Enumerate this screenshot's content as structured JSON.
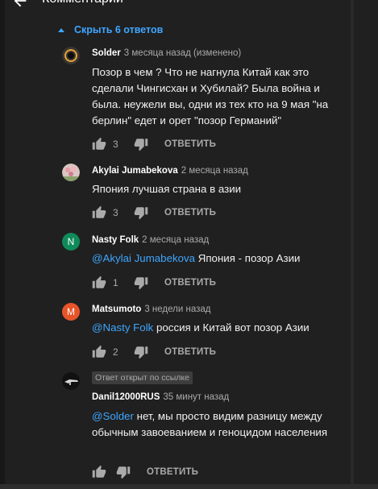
{
  "header": {
    "title": "Комментарии",
    "back_icon": "arrow-left-icon"
  },
  "collapse_label": "Скрыть 6 ответов",
  "colors": {
    "background": "#202020",
    "link": "#3ea6ff",
    "text": "#f1f1f1",
    "secondary": "#aaaaaa",
    "avatar_n": "#0f8b5a",
    "avatar_m": "#e8542a"
  },
  "replies": [
    {
      "author": "Solder",
      "time": "3 месяца назад (изменено)",
      "text": "Позор в чем ? Что не нагнула Китай как это сделали Чингисхан и Хубилай?   Была война и была. неужели вы, одни из тех кто на 9 мая \"на берлин\" едет и орет \"позор Германий\"",
      "likes": "3",
      "reply_label": "ОТВЕТИТЬ"
    },
    {
      "author": "Akylai Jumabekova",
      "time": "2 месяца назад",
      "text": "Япония лучшая страна в азии",
      "likes": "3",
      "reply_label": "ОТВЕТИТЬ"
    },
    {
      "author": "Nasty Folk",
      "avatar_letter": "N",
      "time": "2 месяца назад",
      "mention": "@Akylai Jumabekova",
      "text": " Япония - позор Азии",
      "likes": "1",
      "reply_label": "ОТВЕТИТЬ"
    },
    {
      "author": "Matsumoto",
      "avatar_letter": "M",
      "time": "3 недели назад",
      "mention": "@Nasty Folk",
      "text": " россия и Китай вот позор Азии",
      "likes": "2",
      "reply_label": "ОТВЕТИТЬ"
    },
    {
      "badge": "Ответ открыт по ссылке",
      "author": "Danil12000RUS",
      "time": "35 минут назад",
      "mention": "@Solder",
      "text": " нет, мы просто видим разницу между обычным завоеванием и геноцидом населения",
      "reply_label": "ОТВЕТИТЬ"
    }
  ]
}
